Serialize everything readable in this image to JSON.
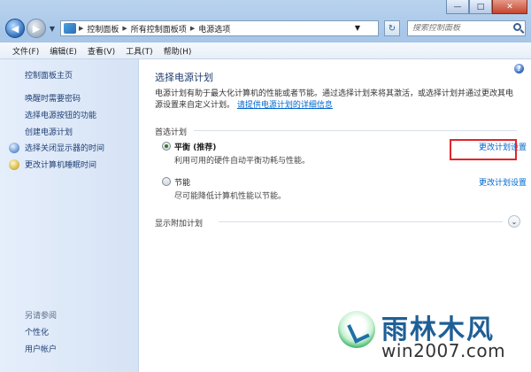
{
  "window": {
    "caption_buttons": [
      "—",
      "□",
      "✕"
    ]
  },
  "address_bar": {
    "breadcrumbs": [
      "控制面板",
      "所有控制面板项",
      "电源选项"
    ]
  },
  "search": {
    "placeholder": "搜索控制面板"
  },
  "menu": [
    {
      "label": "文件(F)"
    },
    {
      "label": "编辑(E)"
    },
    {
      "label": "查看(V)"
    },
    {
      "label": "工具(T)"
    },
    {
      "label": "帮助(H)"
    }
  ],
  "sidebar": {
    "home": "控制面板主页",
    "links": [
      "唤醒时需要密码",
      "选择电源按钮的功能",
      "创建电源计划"
    ],
    "icon_links": [
      {
        "label": "选择关闭显示器的时间",
        "icon": "display-icon"
      },
      {
        "label": "更改计算机睡眠时间",
        "icon": "moon-icon"
      }
    ],
    "see_also": "另请参阅",
    "see_also_links": [
      "个性化",
      "用户帐户"
    ]
  },
  "main": {
    "title": "选择电源计划",
    "description": "电源计划有助于最大化计算机的性能或者节能。通过选择计划来将其激活，或选择计划并通过更改其电源设置来自定义计划。",
    "description_link": "请提供电源计划的详细信息",
    "section_label": "首选计划",
    "plans": [
      {
        "name": "平衡 (推荐)",
        "desc": "利用可用的硬件自动平衡功耗与性能。",
        "link": "更改计划设置",
        "selected": true
      },
      {
        "name": "节能",
        "desc": "尽可能降低计算机性能以节能。",
        "link": "更改计划设置",
        "selected": false
      }
    ],
    "show_more": "显示附加计划",
    "help_glyph": "?",
    "chevron_glyph": "⌄"
  },
  "watermark": {
    "title": "雨林木风",
    "url": "win2007.com"
  },
  "colors": {
    "link": "#0066cc",
    "highlight": "#e0262b",
    "title": "#1e3b6d"
  }
}
